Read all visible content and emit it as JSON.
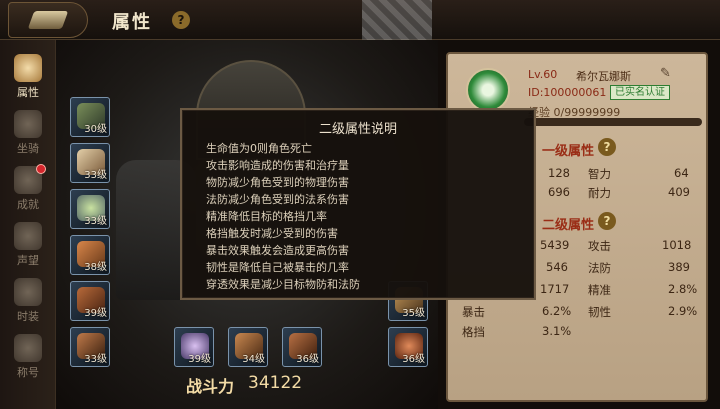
{
  "header": {
    "title": "属性",
    "help_glyph": "?",
    "heart_count": "0"
  },
  "sidebar": {
    "items": [
      {
        "label": "属性",
        "icon": "attribute-icon",
        "active": true
      },
      {
        "label": "坐骑",
        "icon": "mount-icon"
      },
      {
        "label": "成就",
        "icon": "achievement-icon"
      },
      {
        "label": "声望",
        "icon": "reputation-icon"
      },
      {
        "label": "时装",
        "icon": "fashion-icon"
      },
      {
        "label": "称号",
        "icon": "title-icon"
      }
    ]
  },
  "equipment": {
    "left": [
      "30级",
      "33级",
      "33级",
      "38级",
      "39级",
      "33级"
    ],
    "right": [
      "35级",
      "36级"
    ],
    "bottom": [
      "39级",
      "34级",
      "36级"
    ]
  },
  "combat_power": {
    "label": "战斗力",
    "value": "34122"
  },
  "profile": {
    "level": "Lv.60",
    "name": "希尔瓦娜斯",
    "id": "ID:100000061",
    "verified": "已实名认证",
    "exp_label": "经验",
    "exp_value": "0/99999999"
  },
  "primary": {
    "title": "一级属性",
    "rows": [
      {
        "v1": "128",
        "l2": "智力",
        "v2": "64"
      },
      {
        "v1": "696",
        "l2": "耐力",
        "v2": "409"
      }
    ]
  },
  "secondary": {
    "title": "二级属性",
    "rows": [
      {
        "v1": "5439",
        "l2": "攻击",
        "v2": "1018"
      },
      {
        "v1": "546",
        "l2": "法防",
        "v2": "389"
      },
      {
        "v1": "1717",
        "l2": "精准",
        "v2": "2.8%"
      },
      {
        "l1": "暴击",
        "v1": "6.2%",
        "l2": "韧性",
        "v2": "2.9%"
      },
      {
        "l1": "格挡",
        "v1": "3.1%"
      }
    ]
  },
  "dialog": {
    "title": "二级属性说明",
    "lines": [
      "生命值为0则角色死亡",
      "攻击影响造成的伤害和治疗量",
      "物防减少角色受到的物理伤害",
      "法防减少角色受到的法系伤害",
      "精准降低目标的格挡几率",
      "格挡触发时减少受到的伤害",
      "暴击效果触发会造成更高伤害",
      "韧性是降低自己被暴击的几率",
      "穿透效果是减少目标物防和法防"
    ]
  }
}
